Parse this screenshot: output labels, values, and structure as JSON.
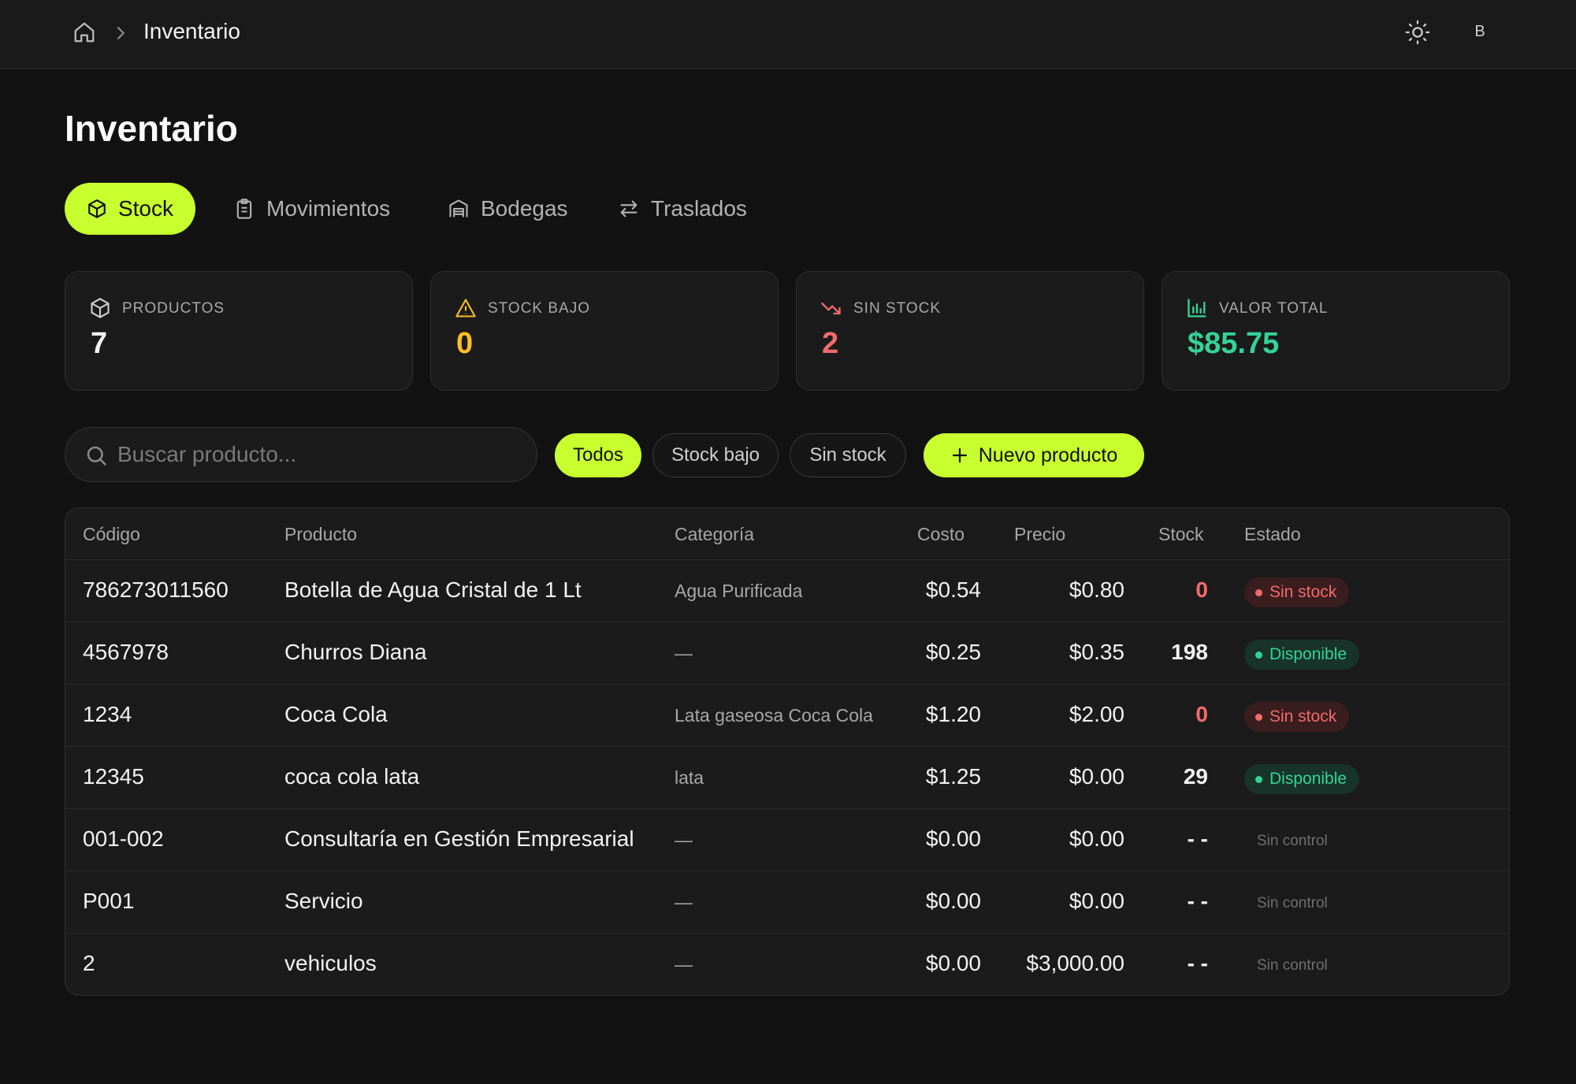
{
  "breadcrumb": {
    "current": "Inventario"
  },
  "header": {
    "avatar_letter": "B"
  },
  "page": {
    "title": "Inventario"
  },
  "tabs": [
    {
      "label": "Stock",
      "icon": "box-icon"
    },
    {
      "label": "Movimientos",
      "icon": "clipboard-icon"
    },
    {
      "label": "Bodegas",
      "icon": "warehouse-icon"
    },
    {
      "label": "Traslados",
      "icon": "transfer-arrows-icon"
    }
  ],
  "stats": {
    "productos": {
      "label": "PRODUCTOS",
      "value": "7",
      "color": "#f2f2f2"
    },
    "stock_bajo": {
      "label": "STOCK BAJO",
      "value": "0",
      "color": "#fbbf24"
    },
    "sin_stock": {
      "label": "SIN STOCK",
      "value": "2",
      "color": "#f26b6b"
    },
    "valor_total": {
      "label": "VALOR TOTAL",
      "value": "$85.75",
      "color": "#34d399"
    }
  },
  "search": {
    "placeholder": "Buscar producto...",
    "value": ""
  },
  "filters": {
    "todos": "Todos",
    "stock_bajo": "Stock bajo",
    "sin_stock": "Sin stock"
  },
  "actions": {
    "new_product": "Nuevo producto"
  },
  "colors": {
    "accent": "#c8ff2e",
    "danger": "#f26b6b",
    "success": "#34d399",
    "warning": "#fbbf24"
  },
  "table": {
    "columns": [
      "Código",
      "Producto",
      "Categoría",
      "Costo",
      "Precio",
      "Stock",
      "Estado"
    ],
    "rows": [
      {
        "codigo": "786273011560",
        "producto": "Botella de Agua Cristal de 1 Lt",
        "categoria": "Agua Purificada",
        "costo": "$0.54",
        "precio": "$0.80",
        "stock": "0",
        "estado": "Sin stock"
      },
      {
        "codigo": "4567978",
        "producto": "Churros Diana",
        "categoria": "—",
        "costo": "$0.25",
        "precio": "$0.35",
        "stock": "198",
        "estado": "Disponible"
      },
      {
        "codigo": "1234",
        "producto": "Coca Cola",
        "categoria": "Lata gaseosa Coca Cola",
        "costo": "$1.20",
        "precio": "$2.00",
        "stock": "0",
        "estado": "Sin stock"
      },
      {
        "codigo": "12345",
        "producto": "coca cola lata",
        "categoria": "lata",
        "costo": "$1.25",
        "precio": "$0.00",
        "stock": "29",
        "estado": "Disponible"
      },
      {
        "codigo": "001-002",
        "producto": "Consultaría en Gestión Empresarial",
        "categoria": "—",
        "costo": "$0.00",
        "precio": "$0.00",
        "stock": "- -",
        "estado": "Sin control"
      },
      {
        "codigo": "P001",
        "producto": "Servicio",
        "categoria": "—",
        "costo": "$0.00",
        "precio": "$0.00",
        "stock": "- -",
        "estado": "Sin control"
      },
      {
        "codigo": "2",
        "producto": "vehiculos",
        "categoria": "—",
        "costo": "$0.00",
        "precio": "$3,000.00",
        "stock": "- -",
        "estado": "Sin control"
      }
    ]
  }
}
